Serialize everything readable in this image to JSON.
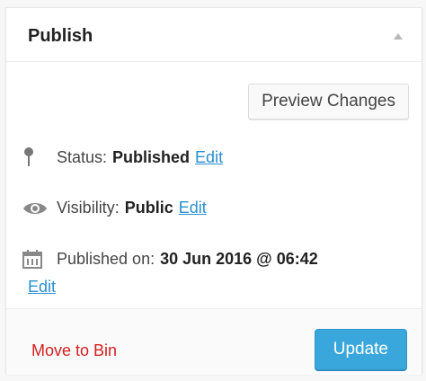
{
  "panel": {
    "title": "Publish",
    "collapse_icon": "triangle-up-icon"
  },
  "preview": {
    "label": "Preview Changes"
  },
  "status": {
    "icon": "pin-icon",
    "label": "Status:",
    "value": "Published",
    "edit": "Edit"
  },
  "visibility": {
    "icon": "eye-icon",
    "label": "Visibility:",
    "value": "Public",
    "edit": "Edit"
  },
  "published": {
    "icon": "calendar-icon",
    "label": "Published on:",
    "value": "30 Jun 2016 @ 06:42",
    "edit": "Edit"
  },
  "footer": {
    "move_to_bin": "Move to Bin",
    "update": "Update"
  },
  "colors": {
    "link": "#2a8fd1",
    "danger": "#d51f1f",
    "primary": "#39a7dc"
  }
}
